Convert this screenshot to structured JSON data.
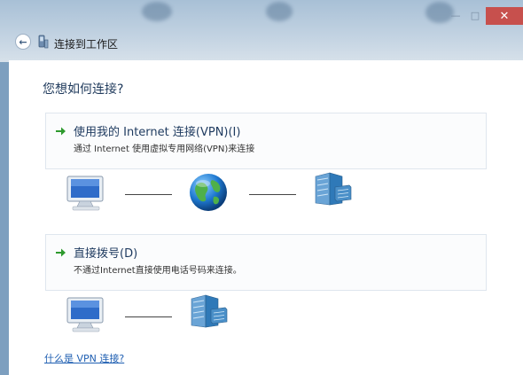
{
  "window": {
    "title": "连接到工作区",
    "minimize_glyph": "—",
    "maximize_glyph": "□",
    "close_glyph": "✕"
  },
  "main": {
    "question": "您想如何连接?",
    "options": [
      {
        "title": "使用我的 Internet 连接(VPN)(I)",
        "description": "通过 Internet 使用虚拟专用网络(VPN)来连接",
        "arrow_icon": "green-arrow-icon"
      },
      {
        "title": "直接拨号(D)",
        "description": "不通过Internet直接使用电话号码来连接。",
        "arrow_icon": "green-arrow-icon"
      }
    ],
    "diagram_vpn": [
      "computer-icon",
      "globe-icon",
      "server-icon"
    ],
    "diagram_dialup": [
      "computer-icon",
      "server-icon"
    ],
    "help_link": "什么是 VPN 连接?"
  },
  "colors": {
    "close_button": "#c7504d",
    "question_text": "#1e395b",
    "link": "#1f5fb2",
    "arrow": "#2e9a2e"
  }
}
